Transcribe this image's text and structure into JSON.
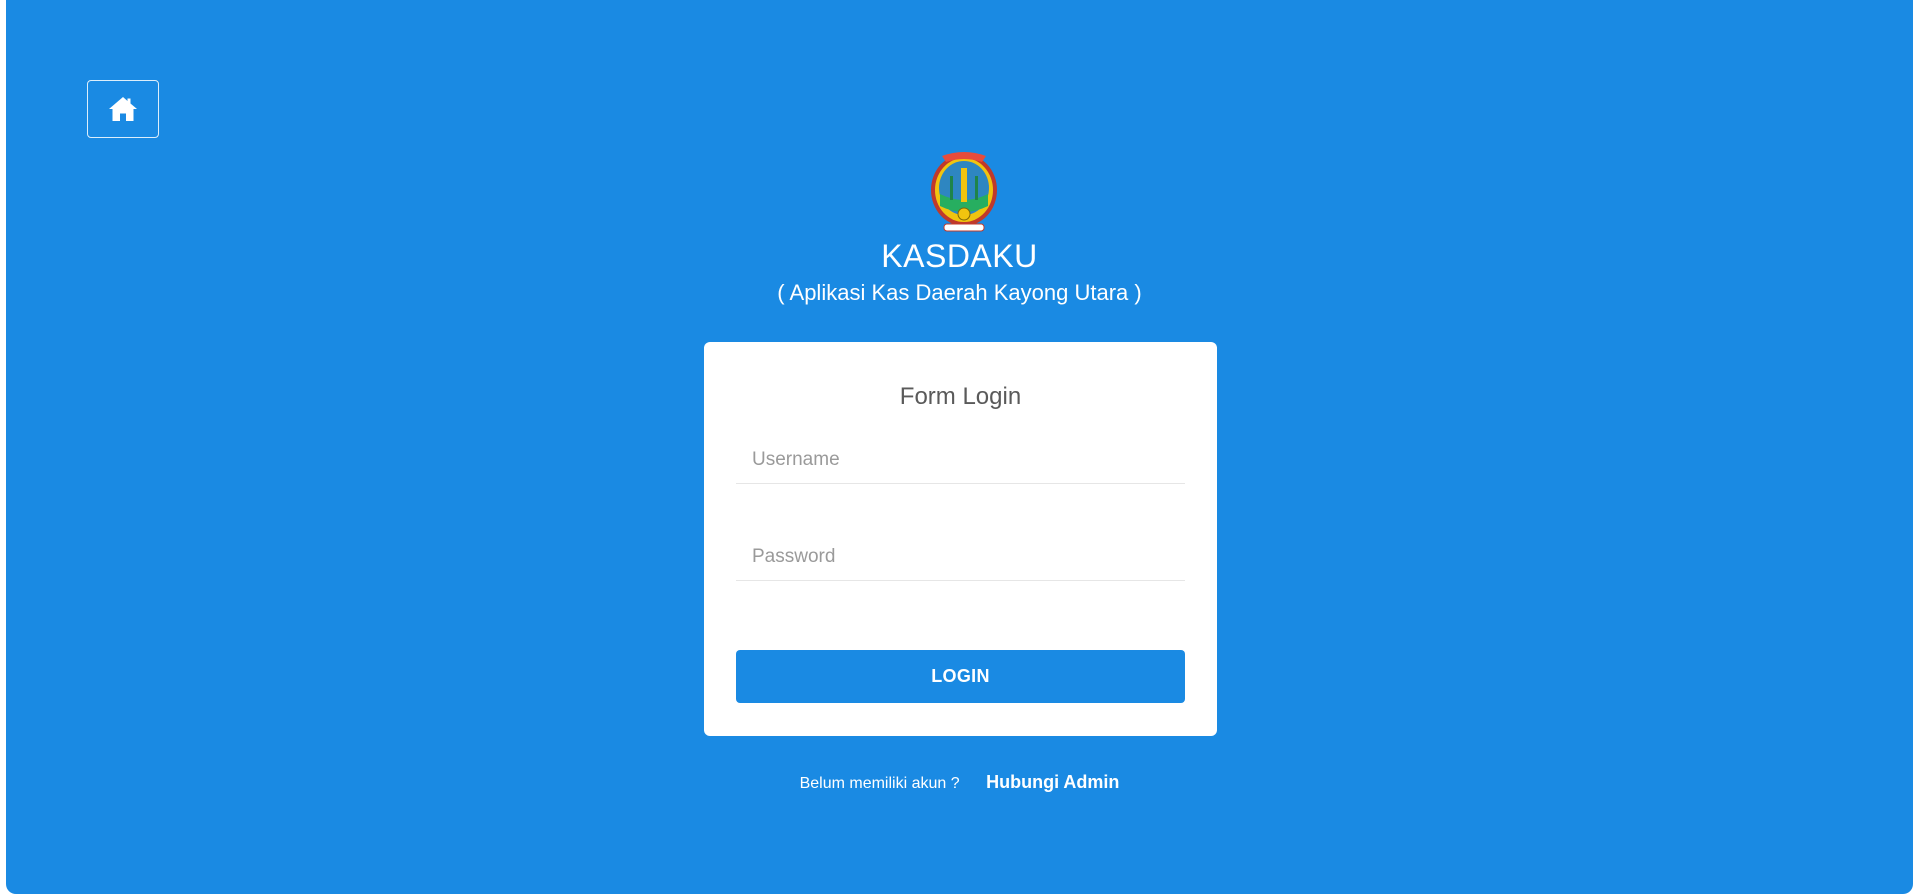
{
  "header": {
    "home_icon": "home-icon",
    "title": "KASDAKU",
    "subtitle": "( Aplikasi Kas Daerah Kayong Utara )",
    "logo": "regional-emblem-logo"
  },
  "login_form": {
    "title": "Form Login",
    "username": {
      "value": "",
      "placeholder": "Username"
    },
    "password": {
      "value": "",
      "placeholder": "Password"
    },
    "submit_label": "LOGIN"
  },
  "footer": {
    "question": "Belum memiliki akun ?",
    "link_label": "Hubungi Admin"
  },
  "colors": {
    "brand_blue": "#1a8ae3",
    "card_background": "#ffffff",
    "title_gray": "#5a5a5a",
    "placeholder_gray": "#9a9a9a"
  }
}
